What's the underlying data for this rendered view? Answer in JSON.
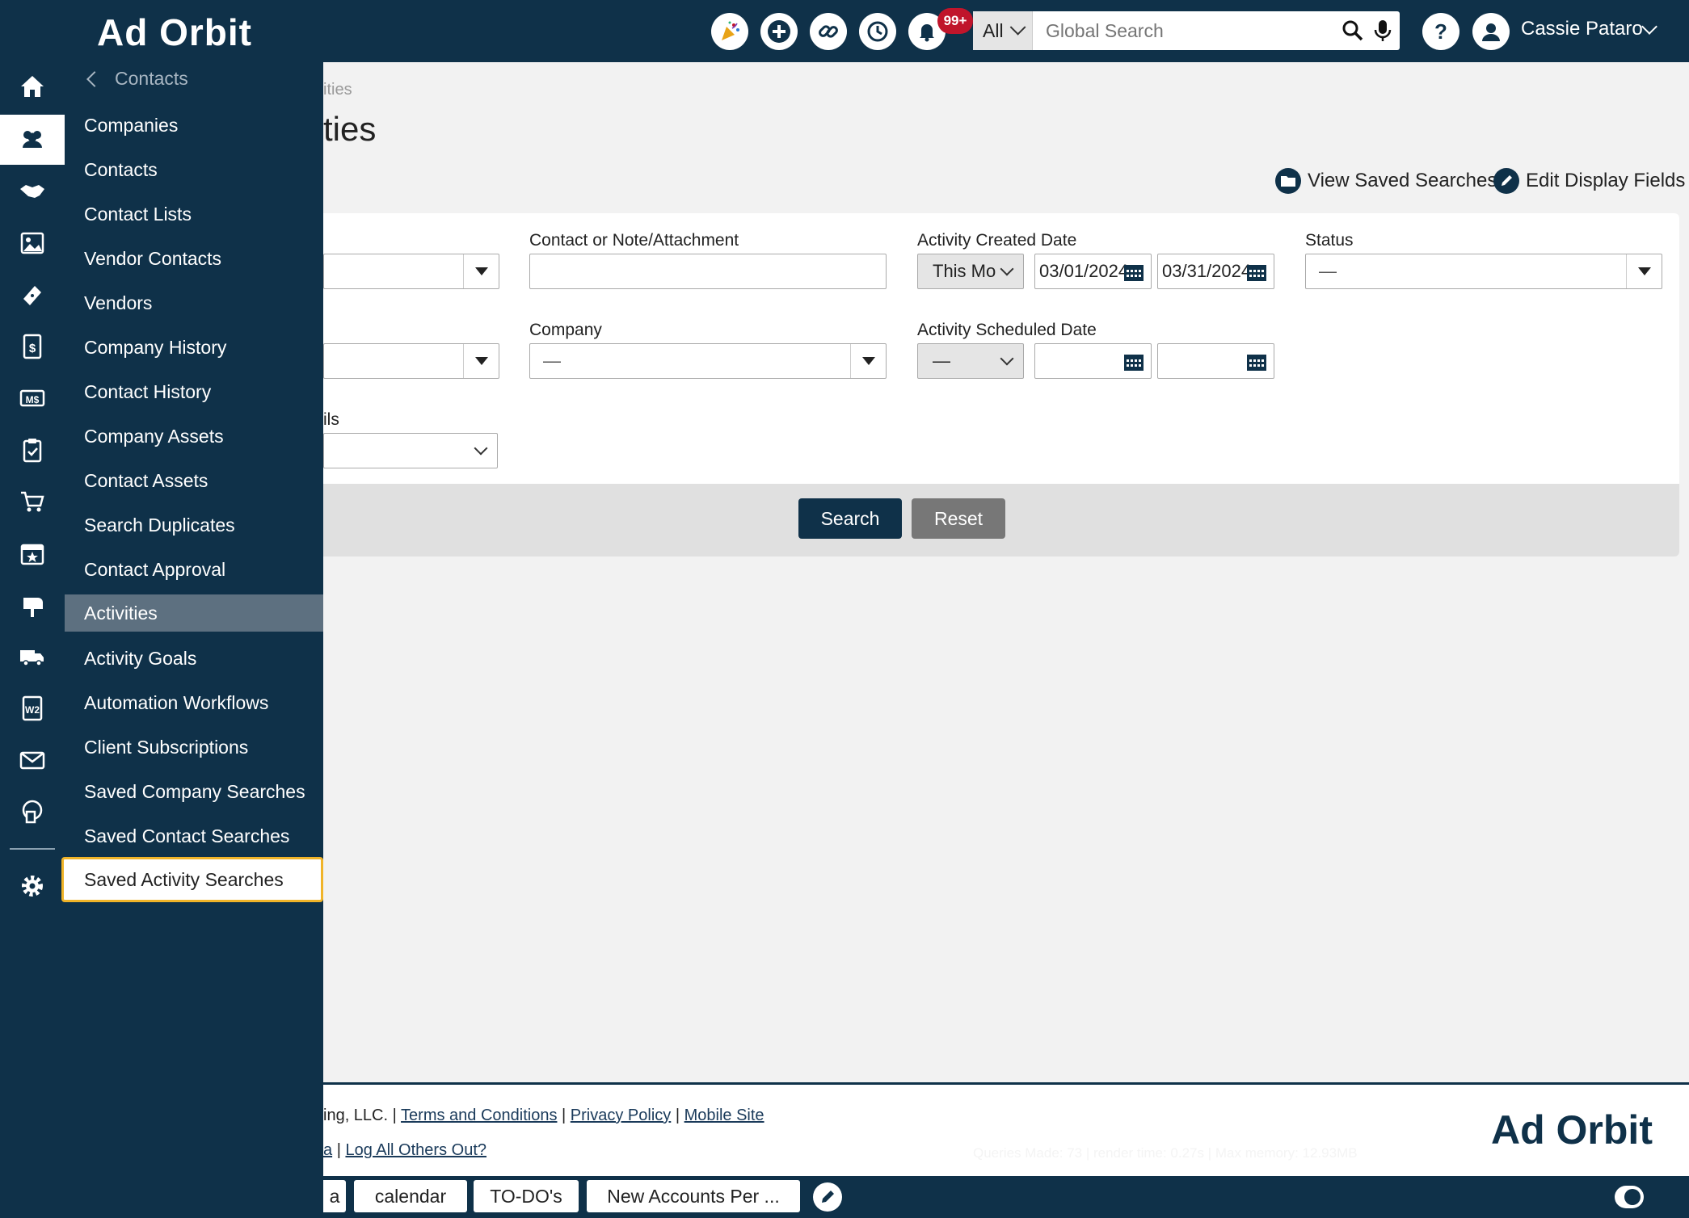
{
  "header": {
    "search_scope": "All",
    "search_placeholder": "Global Search",
    "notification_count": "99+",
    "user_name": "Cassie Pataro"
  },
  "brand": {
    "logo_text": "Ad Orbit"
  },
  "submenu": {
    "back_label": "Contacts",
    "items": [
      {
        "label": "Companies"
      },
      {
        "label": "Contacts"
      },
      {
        "label": "Contact Lists"
      },
      {
        "label": "Vendor Contacts"
      },
      {
        "label": "Vendors"
      },
      {
        "label": "Company History"
      },
      {
        "label": "Contact History"
      },
      {
        "label": "Company Assets"
      },
      {
        "label": "Contact Assets"
      },
      {
        "label": "Search Duplicates"
      },
      {
        "label": "Contact Approval"
      },
      {
        "label": "Activities"
      },
      {
        "label": "Activity Goals"
      },
      {
        "label": "Automation Workflows"
      },
      {
        "label": "Client Subscriptions"
      },
      {
        "label": "Saved Company Searches"
      },
      {
        "label": "Saved Contact Searches"
      },
      {
        "label": "Saved Activity Searches"
      }
    ]
  },
  "page": {
    "breadcrumb": "ities",
    "title": "ties",
    "view_saved_searches": "View Saved Searches",
    "edit_display_fields": "Edit Display Fields"
  },
  "form": {
    "contact_note_label": "Contact or Note/Attachment",
    "activity_created_label": "Activity Created Date",
    "activity_created_range": "This Mo",
    "created_from": "03/01/2024",
    "created_to": "03/31/2024",
    "status_label": "Status",
    "status_value": "—",
    "company_label": "Company",
    "company_value": "—",
    "activity_scheduled_label": "Activity Scheduled Date",
    "scheduled_range": "—",
    "partial_label": "ils",
    "search_button": "Search",
    "reset_button": "Reset"
  },
  "footer": {
    "company_fragment": "ing, LLC.",
    "sep": "|",
    "terms": "Terms and Conditions",
    "privacy": "Privacy Policy",
    "mobile": "Mobile Site",
    "line2_fragment": "a",
    "logout_others": "Log All Others Out?",
    "stats": "Queries Made: 73 | render time: 0.27s | Max memory: 12.93MB",
    "logo_text": "Ad Orbit"
  },
  "quick_tabs": [
    {
      "label": "a"
    },
    {
      "label": "calendar"
    },
    {
      "label": "TO-DO's"
    },
    {
      "label": "New Accounts Per ..."
    }
  ],
  "colors": {
    "navy": "#0f3149",
    "active_item": "#5d7080",
    "focus_ring": "#f0b429",
    "reset_button": "#777777",
    "badge": "#c0152b"
  }
}
